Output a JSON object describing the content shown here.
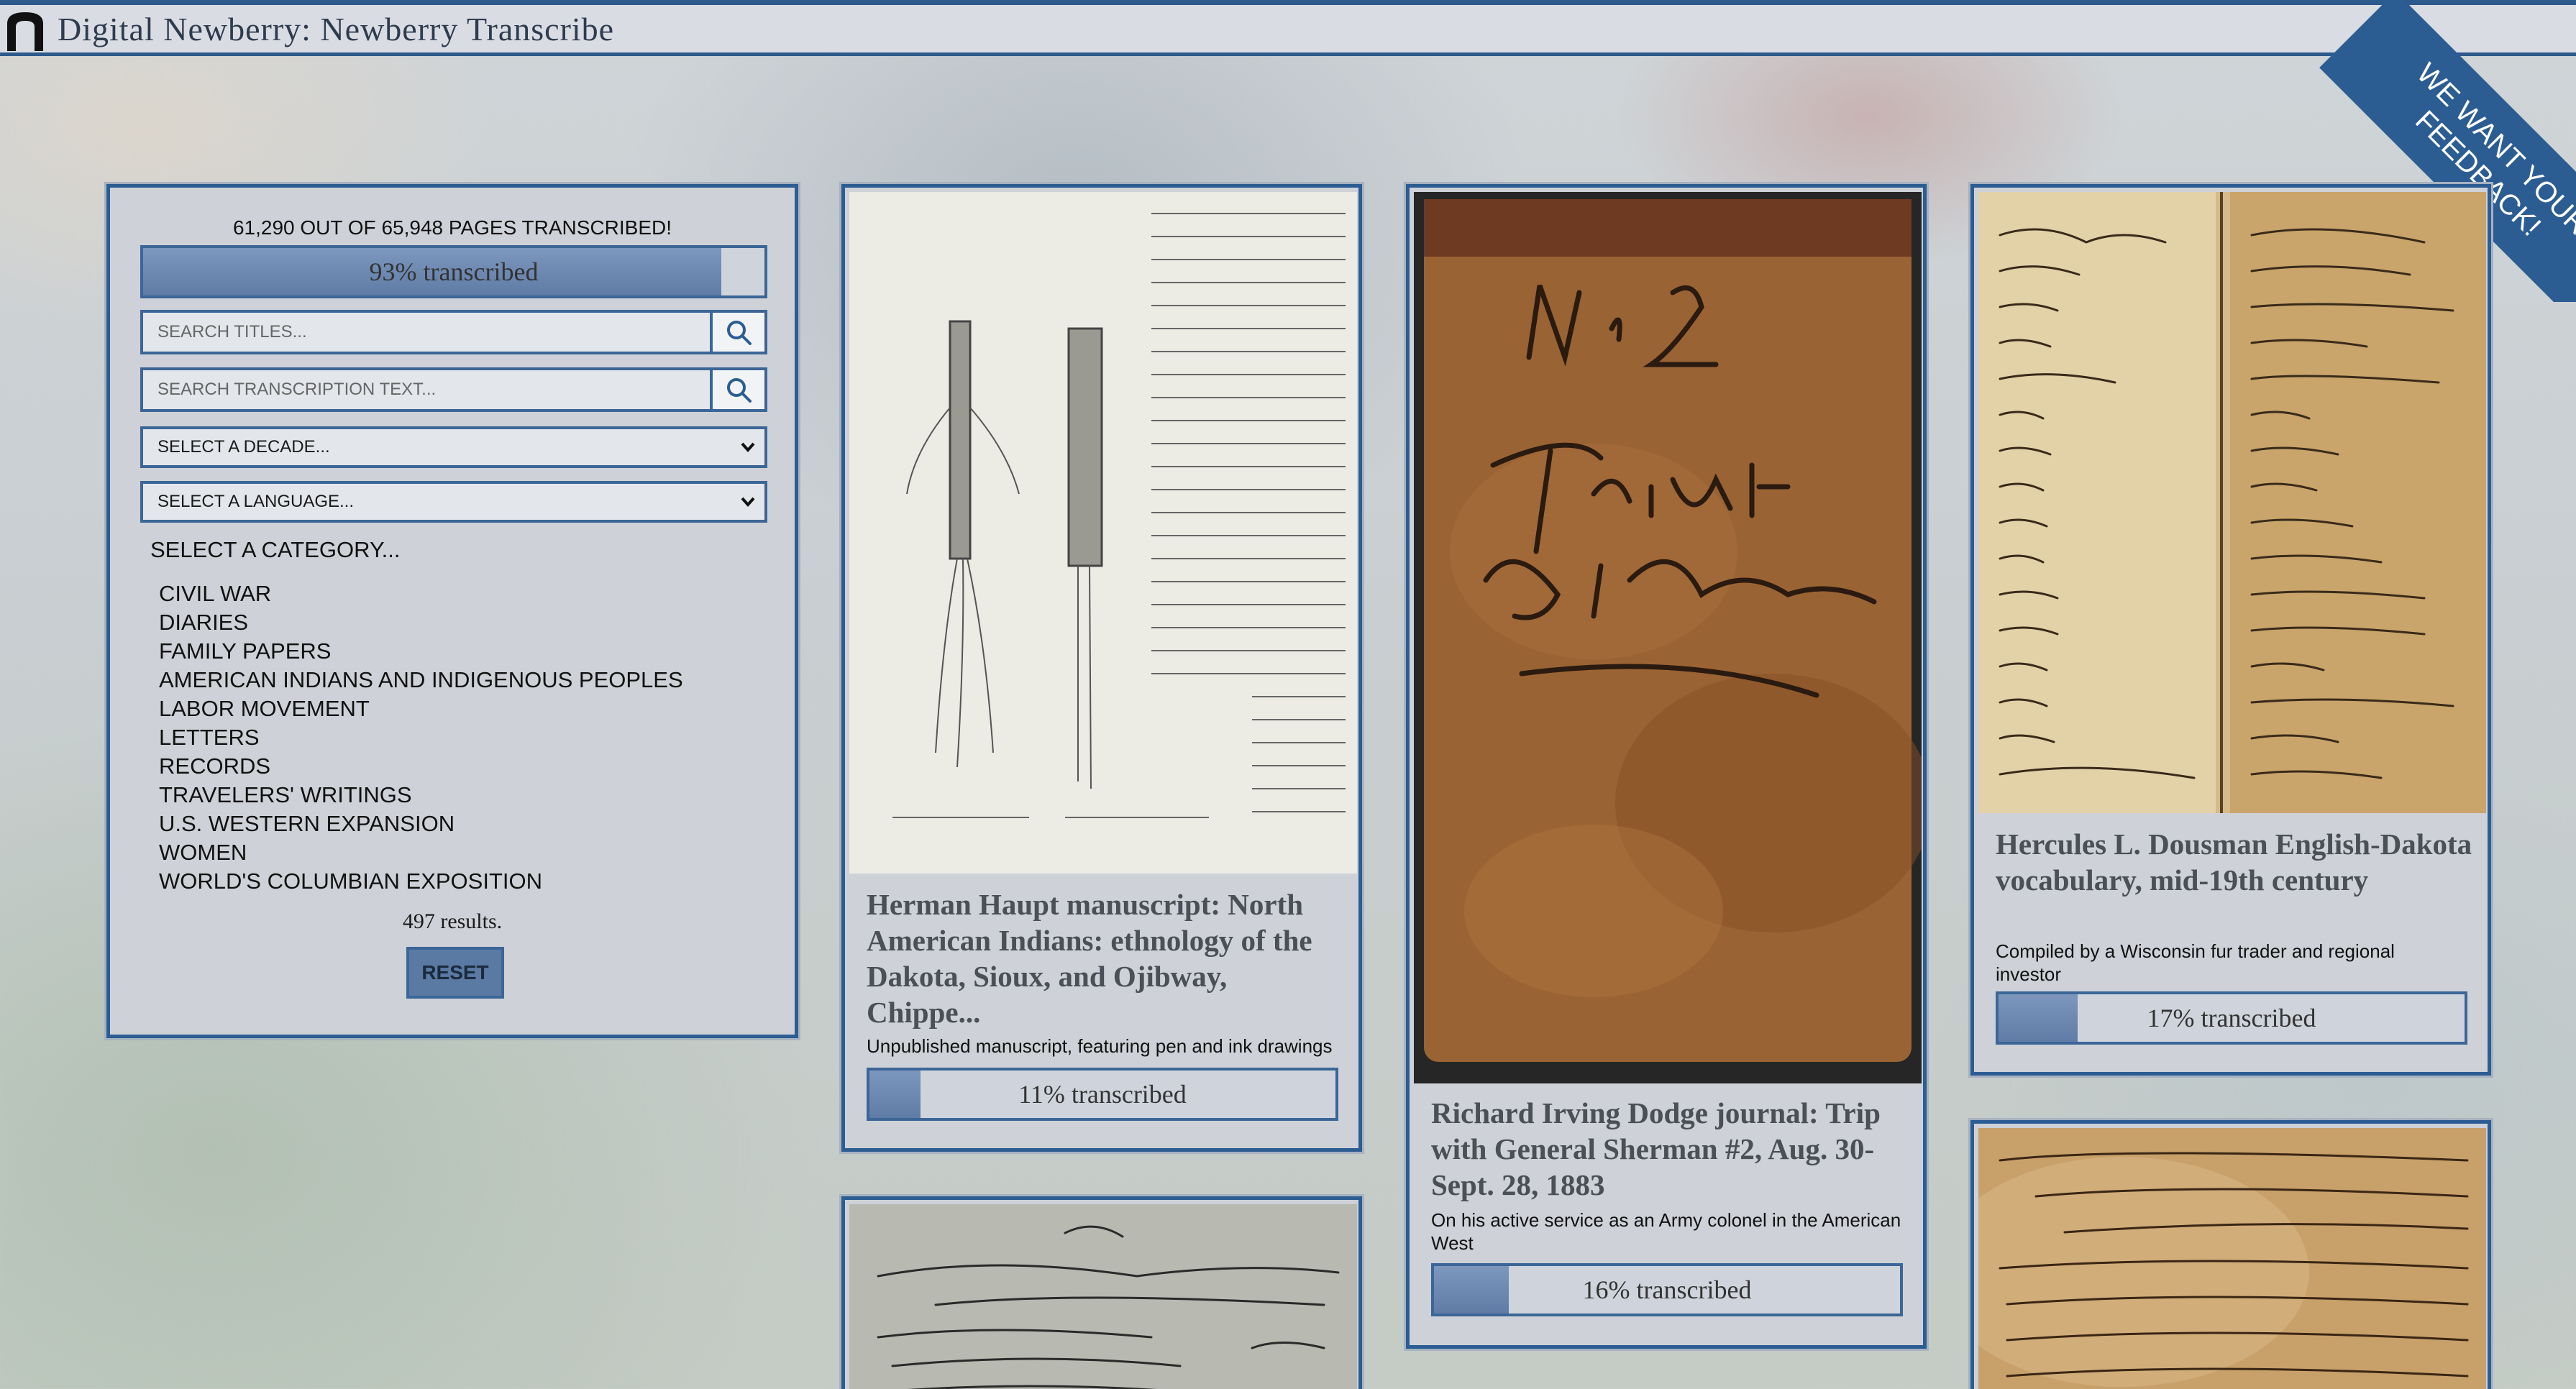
{
  "header": {
    "site_title": "Digital Newberry:  Newberry Transcribe",
    "feedback_ribbon": "WE WANT YOUR FEEDBACK!"
  },
  "filters": {
    "pages_summary": "61,290 OUT OF 65,948 PAGES TRANSCRIBED!",
    "overall_progress": {
      "percent": 93,
      "label": "93% transcribed"
    },
    "search_titles_placeholder": "SEARCH TITLES...",
    "search_text_placeholder": "SEARCH TRANSCRIPTION TEXT...",
    "decade_select": "SELECT A DECADE...",
    "language_select": "SELECT A LANGUAGE...",
    "category_heading": "SELECT A CATEGORY...",
    "categories": [
      "CIVIL WAR",
      "DIARIES",
      "FAMILY PAPERS",
      "AMERICAN INDIANS AND INDIGENOUS PEOPLES",
      "LABOR MOVEMENT",
      "LETTERS",
      "RECORDS",
      "TRAVELERS' WRITINGS",
      "U.S. WESTERN EXPANSION",
      "WOMEN",
      "WORLD'S COLUMBIAN EXPOSITION"
    ],
    "results": "497 results.",
    "reset_label": "RESET"
  },
  "cards": [
    {
      "title": "Herman Haupt manuscript: North American Indians: ethnology of the Dakota, Sioux, and Ojibway, Chippe...",
      "description": "Unpublished manuscript, featuring pen and ink drawings",
      "percent": 11,
      "progress_label": "11% transcribed"
    },
    {
      "title": "Richard Irving Dodge journal: Trip with General Sherman #2, Aug. 30-Sept. 28, 1883",
      "description": "On his active service as an Army colonel in the American West",
      "percent": 16,
      "progress_label": "16% transcribed"
    },
    {
      "title": "Hercules L. Dousman English-Dakota vocabulary, mid-19th century",
      "description": "Compiled by a Wisconsin fur trader and regional investor",
      "percent": 17,
      "progress_label": "17% transcribed"
    }
  ],
  "colors": {
    "accent": "#2c5d92",
    "progress_fill": "#6e89b2",
    "panel": "#ced1d7"
  },
  "icons": {
    "logo": "newberry-arch-logo",
    "search": "magnifier-icon",
    "dropdown": "chevron-down-icon"
  }
}
